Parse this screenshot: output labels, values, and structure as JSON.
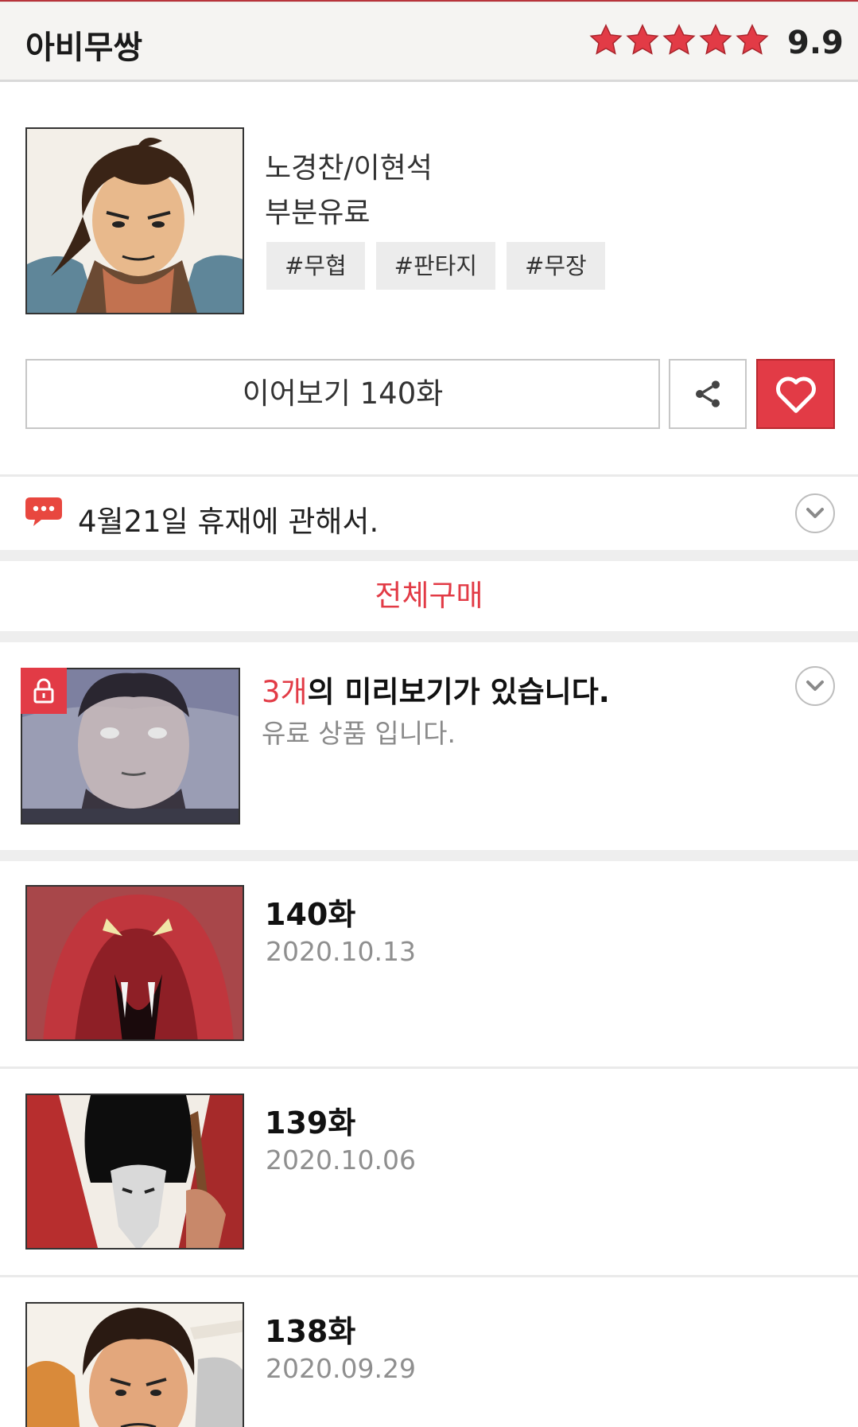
{
  "header": {
    "title": "아비무쌍",
    "rating": "9.9",
    "stars_filled": 5,
    "star_color": "#e23b46"
  },
  "info": {
    "author": "노경찬/이현석",
    "pricing": "부분유료",
    "tags": [
      "#무협",
      "#판타지",
      "#무장"
    ],
    "continue_label": "이어보기 140화",
    "share_icon": "share-icon",
    "like_icon": "heart-icon"
  },
  "notice": {
    "text": "4월21일 휴재에 관해서."
  },
  "buy_all": {
    "label": "전체구매"
  },
  "preview": {
    "count": "3개",
    "headline_rest": "의 미리보기가 있습니다.",
    "sub": "유료 상품 입니다."
  },
  "episodes": [
    {
      "number": "140화",
      "date": "2020.10.13"
    },
    {
      "number": "139화",
      "date": "2020.10.06"
    },
    {
      "number": "138화",
      "date": "2020.09.29"
    }
  ],
  "colors": {
    "accent": "#e23b46",
    "header_bg": "#f5f4f2",
    "muted_text": "#8f8f8f"
  }
}
